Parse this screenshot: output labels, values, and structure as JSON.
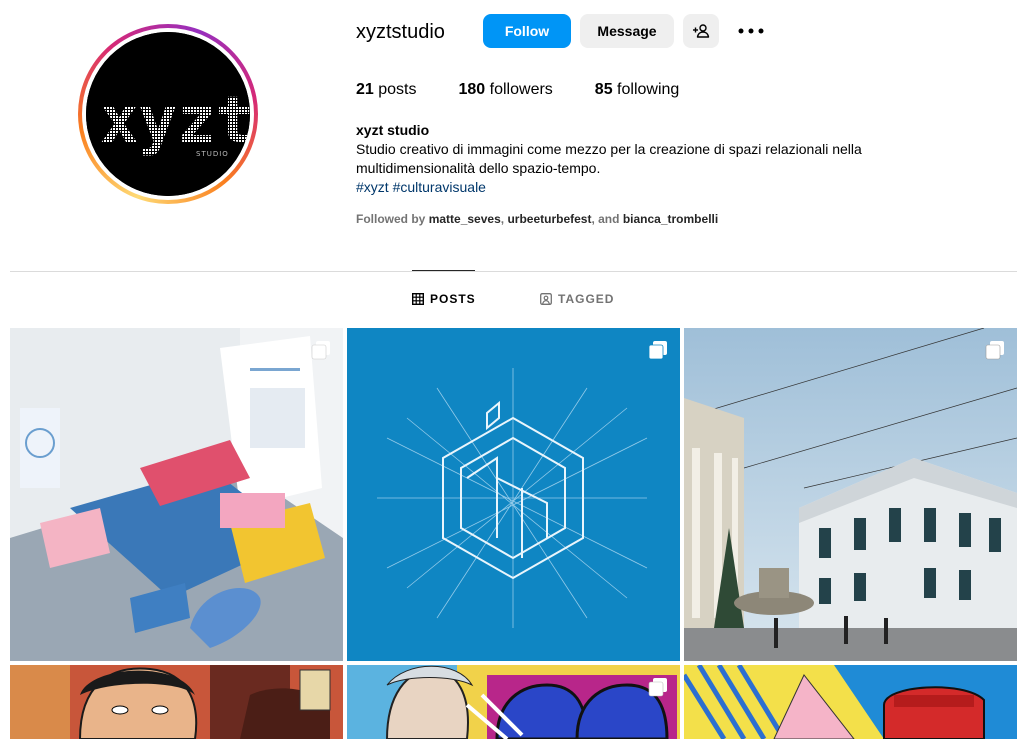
{
  "profile": {
    "username": "xyztstudio",
    "logo_text": "xyzt",
    "logo_subtext": "STUDIO"
  },
  "actions": {
    "follow_label": "Follow",
    "message_label": "Message",
    "add_user_icon": "add-user-icon",
    "more_icon": "more-horizontal-icon"
  },
  "stats": {
    "posts_count": "21",
    "posts_label": "posts",
    "followers_count": "180",
    "followers_label": "followers",
    "following_count": "85",
    "following_label": "following"
  },
  "bio": {
    "name": "xyzt studio",
    "line1": "Studio creativo di immagini come mezzo per la creazione di spazi relazionali nella",
    "line2": "multidimensionalità dello spazio-tempo.",
    "hashtag1": "#xyzt",
    "hashtag2": "#culturavisuale"
  },
  "followed_by": {
    "prefix": "Followed by",
    "user1": "matte_seves",
    "sep1": ",",
    "user2": "urbeeturbefest",
    "sep2": ", and",
    "user3": "bianca_trombelli"
  },
  "tabs": [
    {
      "label": "POSTS",
      "icon": "grid-icon",
      "active": true
    },
    {
      "label": "TAGGED",
      "icon": "tag-icon",
      "active": false
    }
  ],
  "posts": [
    {
      "subject": "stationery mockup",
      "icon": "multiple-posts-icon"
    },
    {
      "subject": "blue geometric logo",
      "icon": "multiple-posts-icon"
    },
    {
      "subject": "palace square photo",
      "icon": "multiple-posts-icon"
    },
    {
      "subject": "painted portrait"
    },
    {
      "subject": "painted portrait colorful",
      "icon": "multiple-posts-icon"
    },
    {
      "subject": "painted abstract"
    }
  ],
  "colors": {
    "follow_blue": "#0095f6",
    "button_gray": "#efefef",
    "hashtag_blue": "#00376b",
    "muted_text": "#737373"
  }
}
